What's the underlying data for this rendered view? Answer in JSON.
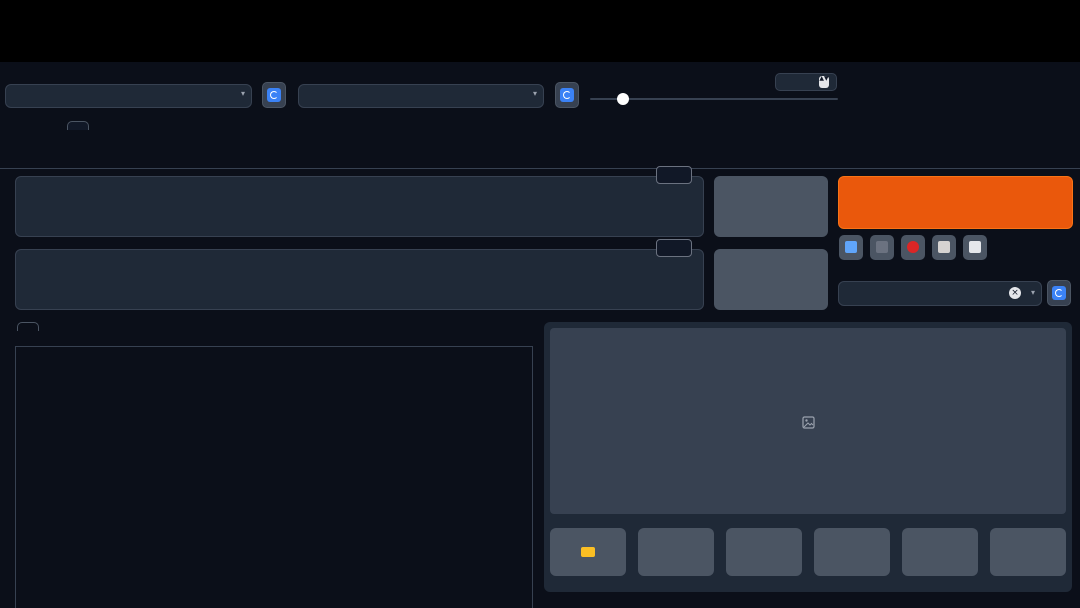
{
  "overlay_title": "",
  "top_controls": {
    "ckpt_label": "",
    "ckpt_value": "",
    "vae_label": "",
    "vae_value": "",
    "clip_label": "",
    "clip_value": "",
    "clip_fraction": 0.02
  },
  "main_tabs": [
    "",
    "",
    "",
    "",
    "",
    "",
    "",
    "",
    "",
    "",
    "",
    ""
  ],
  "main_tabs_row2": [
    "",
    "",
    "",
    "",
    "",
    ""
  ],
  "prompt": {
    "placeholder": "",
    "sub": "",
    "counter": ""
  },
  "negative_prompt": {
    "placeholder": "",
    "sub": "",
    "counter": ""
  },
  "buttons": {
    "clip_interrogate": "",
    "deepbooru": "",
    "generate": ""
  },
  "style": {
    "label": "",
    "value": ""
  },
  "sub_tabs": [
    "",
    "",
    "",
    "",
    "",
    ""
  ],
  "upload": {
    "drag_text": "",
    "or_text": "",
    "click_text": ""
  },
  "output_buttons": [
    "",
    "",
    "",
    "",
    "",
    ""
  ],
  "icons": [
    "refresh-icon",
    "image-placeholder-icon",
    "folder-icon",
    "paste-icon",
    "trash-icon",
    "red-button-icon",
    "clipboard-icon",
    "save-disk-icon",
    "clear-x-icon",
    "chevron-down-icon"
  ],
  "colors": {
    "accent": "#ea580c",
    "background": "#0b0f19",
    "panel": "#1f2937",
    "button": "#4b5563"
  }
}
